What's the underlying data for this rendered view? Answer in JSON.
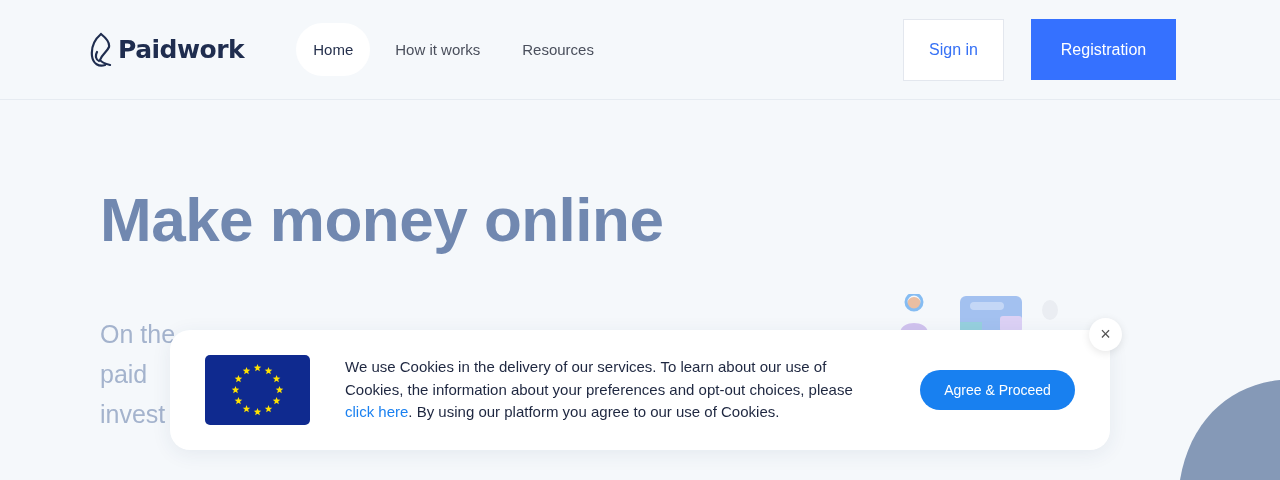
{
  "header": {
    "logo": "Paidwork",
    "nav": [
      {
        "label": "Home",
        "selected": true
      },
      {
        "label": "How it works",
        "selected": false
      },
      {
        "label": "Resources",
        "selected": false
      }
    ],
    "sign_in": "Sign in",
    "registration": "Registration"
  },
  "hero": {
    "title": "Make money online",
    "lines": [
      "On the",
      "paid",
      "invest"
    ]
  },
  "cookie_banner": {
    "text_before": "We use Cookies in the delivery of our services. To learn about our use of Cookies, the information about your preferences and opt-out choices, please ",
    "link": "click here",
    "text_after": ". By using our platform you agree to our use of Cookies.",
    "button": "Agree & Proceed",
    "close": "×"
  }
}
